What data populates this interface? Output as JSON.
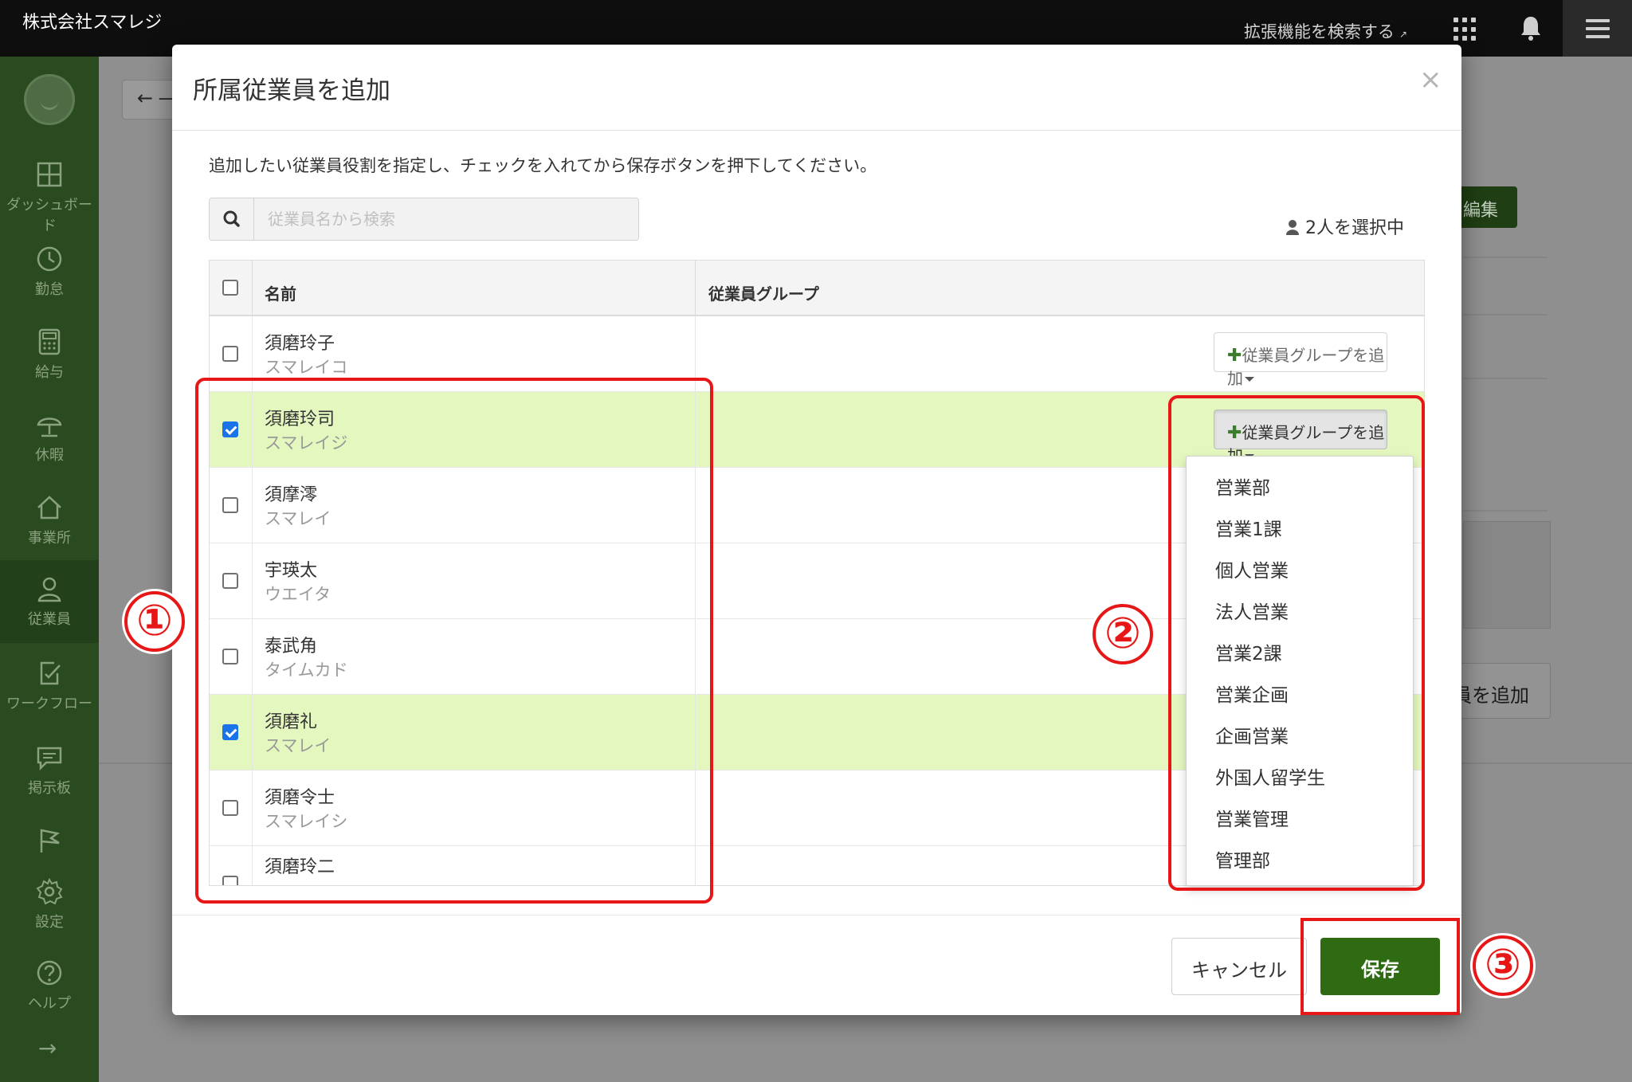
{
  "topbar": {
    "company": "株式会社スマレジ",
    "ext_search": "拡張機能を検索する",
    "ext_icon": "external-link-icon",
    "apps_icon": "apps-grid-icon",
    "bell_icon": "bell-icon",
    "menu_icon": "hamburger-menu-icon"
  },
  "sidebar": {
    "items": [
      {
        "label": "ダッシュボード",
        "icon": "dashboard-icon"
      },
      {
        "label": "勤怠",
        "icon": "clock-icon"
      },
      {
        "label": "給与",
        "icon": "calculator-icon"
      },
      {
        "label": "休暇",
        "icon": "umbrella-icon"
      },
      {
        "label": "事業所",
        "icon": "home-icon"
      },
      {
        "label": "従業員",
        "icon": "person-icon",
        "active": true
      },
      {
        "label": "ワークフロー",
        "icon": "workflow-icon"
      },
      {
        "label": "掲示板",
        "icon": "message-board-icon"
      },
      {
        "label": "",
        "icon": "flag-icon"
      },
      {
        "label": "設定",
        "icon": "gear-icon"
      },
      {
        "label": "ヘルプ",
        "icon": "help-icon"
      }
    ],
    "expand_arrow": "→"
  },
  "background": {
    "back_button": "← ―",
    "edit_button": "を編集",
    "add_button": "員を追加"
  },
  "modal": {
    "title": "所属従業員を追加",
    "close": "×",
    "instruction": "追加したい従業員役割を指定し、チェックを入れてから保存ボタンを押下してください。",
    "search_placeholder": "従業員名から検索",
    "selected_count": "2人を選択中",
    "table": {
      "headers": {
        "name": "名前",
        "group": "従業員グループ"
      },
      "rows": [
        {
          "name": "須磨玲子",
          "kana": "スマレイコ",
          "checked": false
        },
        {
          "name": "須磨玲司",
          "kana": "スマレイジ",
          "checked": true
        },
        {
          "name": "須摩澪",
          "kana": "スマレイ",
          "checked": false
        },
        {
          "name": "宇瑛太",
          "kana": "ウエイタ",
          "checked": false
        },
        {
          "name": "泰武角",
          "kana": "タイムカド",
          "checked": false
        },
        {
          "name": "須磨礼",
          "kana": "スマレイ",
          "checked": true
        },
        {
          "name": "須磨令士",
          "kana": "スマレイシ",
          "checked": false
        },
        {
          "name": "須磨玲二",
          "kana": "",
          "checked": false
        }
      ],
      "add_group_label": "従業員グループを追加",
      "add_group_plus": "✚"
    },
    "group_options": [
      "営業部",
      "営業1課",
      "個人営業",
      "法人営業",
      "営業2課",
      "営業企画",
      "企画営業",
      "外国人留学生",
      "営業管理",
      "管理部"
    ],
    "cancel": "キャンセル",
    "save": "保存"
  },
  "annotations": [
    "①",
    "②",
    "③"
  ],
  "colors": {
    "sidebar": "#2a4a1f",
    "selected_row": "#e4f7bf",
    "save_button": "#2f6b12",
    "annotation": "#e81717",
    "checkbox_checked": "#1a73e8"
  }
}
